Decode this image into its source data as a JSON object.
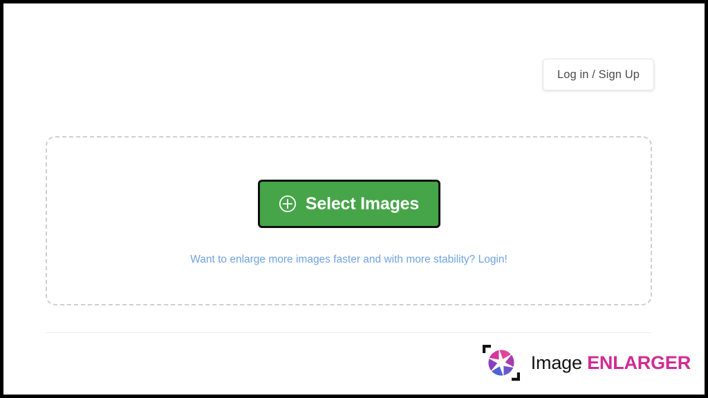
{
  "page": {
    "background_color": "#ffffff",
    "frame_color": "#000000"
  },
  "header": {
    "login_button_label": "Log in / Sign Up"
  },
  "dropzone": {
    "select_button_label": "Select Images",
    "select_button_icon": "circle-plus-icon",
    "select_button_color": "#46a548",
    "select_button_border_color": "#0d0d0d",
    "upgrade_link_text": "Want to enlarge more images faster and with more stability? Login!",
    "upgrade_link_color": "#6fa2e0",
    "border_style": "dashed",
    "border_color": "#cfcfcf"
  },
  "footer": {
    "logo_icon": "camera-aperture-icon",
    "brand_name_part1": "Image",
    "brand_name_part2": "ENLARGER",
    "brand_part1_color": "#141414",
    "brand_part2_color": "#d12b93",
    "aperture_colors": {
      "pink": "#e0459a",
      "magenta": "#d6369b",
      "purple": "#8b3fbf",
      "violet": "#7b45c9",
      "indigo": "#5b5fd0",
      "blue": "#4f63d4"
    }
  }
}
